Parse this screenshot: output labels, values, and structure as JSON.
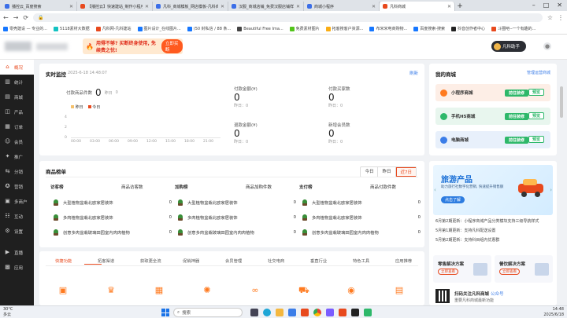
{
  "browser": {
    "tabs": [
      {
        "title": "播控云_百度搜索",
        "color": "#3b6ee8"
      },
      {
        "title": "【播控云】快速建站_制作小程序",
        "color": "#e8491d"
      },
      {
        "title": "凡科_商城模板_网店模板-凡科商城",
        "color": "#3b6ee8"
      },
      {
        "title": "汉服_商城店铺_免费汉服店铺样式",
        "color": "#3b6ee8"
      },
      {
        "title": "商城小程序",
        "color": "#3b6ee8"
      },
      {
        "title": "凡科商城",
        "color": "#e8491d"
      }
    ],
    "active_tab": 5,
    "new_tab": "+",
    "url": "",
    "bookmarks": [
      {
        "label": "零壳建设 — 专业的...",
        "color": "#1677ff"
      },
      {
        "label": "5118素材大数据",
        "color": "#13c2c2"
      },
      {
        "label": "凡科网-凡科建站",
        "color": "#e8491d"
      },
      {
        "label": "图片设计_在线图片...",
        "color": "#1677ff"
      },
      {
        "label": "(50 封私信 / 88 条...",
        "color": "#1677ff"
      },
      {
        "label": "Beautiful Free Ima...",
        "color": "#444"
      },
      {
        "label": "免费素材图片",
        "color": "#52c41a"
      },
      {
        "label": "拓客搜客户资源...",
        "color": "#faad14"
      },
      {
        "label": "布米米电商购物...",
        "color": "#1677ff"
      },
      {
        "label": "百度搜索-搜索",
        "color": "#1677ff"
      },
      {
        "label": "抖音创作者中心",
        "color": "#222"
      },
      {
        "label": "斗圈吧--一个有趣的...",
        "color": "#e8491d"
      }
    ]
  },
  "header": {
    "banner_text": "用得不够? 买断终身使用, 免续费之忧!",
    "banner_button": "立即买断",
    "assistant_label": "凡科助手",
    "user_icon": "user-icon"
  },
  "sidebar": {
    "items": [
      {
        "label": "概况",
        "icon": "⌂"
      },
      {
        "label": "统计",
        "icon": "▥"
      },
      {
        "label": "商城",
        "icon": "▤"
      },
      {
        "label": "产品",
        "icon": "◫"
      },
      {
        "label": "订单",
        "icon": "▦"
      },
      {
        "label": "会员",
        "icon": "☺"
      },
      {
        "label": "推广",
        "icon": "✦"
      },
      {
        "label": "分销",
        "icon": "⇆"
      },
      {
        "label": "营销",
        "icon": "✪"
      },
      {
        "label": "多商户",
        "icon": "▣"
      },
      {
        "label": "互动",
        "icon": "☷"
      },
      {
        "label": "设置",
        "icon": "⚙"
      },
      {
        "label": "直播",
        "icon": "▶"
      },
      {
        "label": "应用",
        "icon": "▩"
      }
    ],
    "active": 0
  },
  "realtime": {
    "title": "实时监控",
    "time": "2025-6-18 14:48:07",
    "refresh": "刷新",
    "paid_products_label": "付款商品件数",
    "paid_products_value": "0",
    "yesterday_prefix": "昨日",
    "yesterday_value": "0",
    "legend_yesterday": "昨日",
    "legend_today": "今日",
    "y_axis": [
      "4",
      "2",
      "0"
    ],
    "x_axis": [
      "00:00",
      "03:00",
      "06:00",
      "09:00",
      "12:00",
      "15:00",
      "18:00",
      "21:00"
    ],
    "kpis": [
      {
        "label": "付款金额(¥)",
        "value": "0",
        "sub": "昨日：0"
      },
      {
        "label": "付款买家数",
        "value": "0",
        "sub": "昨日：0"
      },
      {
        "label": "退款金额(¥)",
        "value": "0",
        "sub": "昨日：0"
      },
      {
        "label": "新增会员数",
        "value": "0",
        "sub": "昨日：0"
      }
    ]
  },
  "ranking": {
    "title": "商品榜单",
    "periods": [
      "今日",
      "昨日",
      "近7日"
    ],
    "active_period": 2,
    "columns": [
      {
        "title": "访客榜",
        "metric": "商品访客数"
      },
      {
        "title": "加购榜",
        "metric": "商品加购件数"
      },
      {
        "title": "支付榜",
        "metric": "商品付款件数"
      }
    ],
    "rows": [
      {
        "name": "大型植物盆栽北欧家居装饰",
        "count": "0"
      },
      {
        "name": "多肉植物盆栽北欧家居装饰",
        "count": "0"
      },
      {
        "name": "创意多肉盆栽玻璃田园室内肉肉植物",
        "count": "0"
      }
    ]
  },
  "quick": {
    "tabs": [
      "快捷功能",
      "拓客渠道",
      "获取更全流",
      "促销神器",
      "会员管理",
      "社交电商",
      "垂直行业",
      "特色工具",
      "应用推荐"
    ],
    "active": 0,
    "icons": [
      "box-icon",
      "crown-icon",
      "grid-icon",
      "gear-icon",
      "link-icon",
      "truck-icon",
      "coin-icon",
      "message-icon"
    ]
  },
  "myshop": {
    "title": "我的商城",
    "manage": "管理运营商城",
    "shops": [
      {
        "name": "小程序商城",
        "bg": "#fdeee6",
        "dot": "#ff7a1f"
      },
      {
        "name": "手机H5商城",
        "bg": "#e8f6ee",
        "dot": "#2eb86a"
      },
      {
        "name": "电脑商城",
        "bg": "#e8f0fb",
        "dot": "#3b7de8"
      }
    ],
    "go_label": "前往装修",
    "preview_label": "预览"
  },
  "promo": {
    "title": "旅游产品",
    "subtitle": "助力旅行社数字化营销, 快速提升销售额",
    "button": "点击了解"
  },
  "updates": {
    "items": [
      "6月第2期更新：小程序商城产品分类模块支持三级导航样式",
      "5月第1期更新：支持凡科配送设置",
      "5月第2期更新：支持科目组内优惠群"
    ]
  },
  "services": [
    {
      "title": "零售解决方案",
      "button": "立即查看"
    },
    {
      "title": "餐饮解决方案",
      "button": "立即查看"
    }
  ],
  "follow": {
    "title": "扫码关注凡科商城",
    "link": "公众号",
    "desc": "重要凡科商城最新功能"
  },
  "taskbar": {
    "temp": "30°C",
    "weather": "多云",
    "search": "搜索",
    "time": "14:48",
    "date": "2025/6/18"
  },
  "colors": {
    "accent": "#e8491d",
    "green": "#2eb86a",
    "sidebar": "#1f1f1f"
  }
}
